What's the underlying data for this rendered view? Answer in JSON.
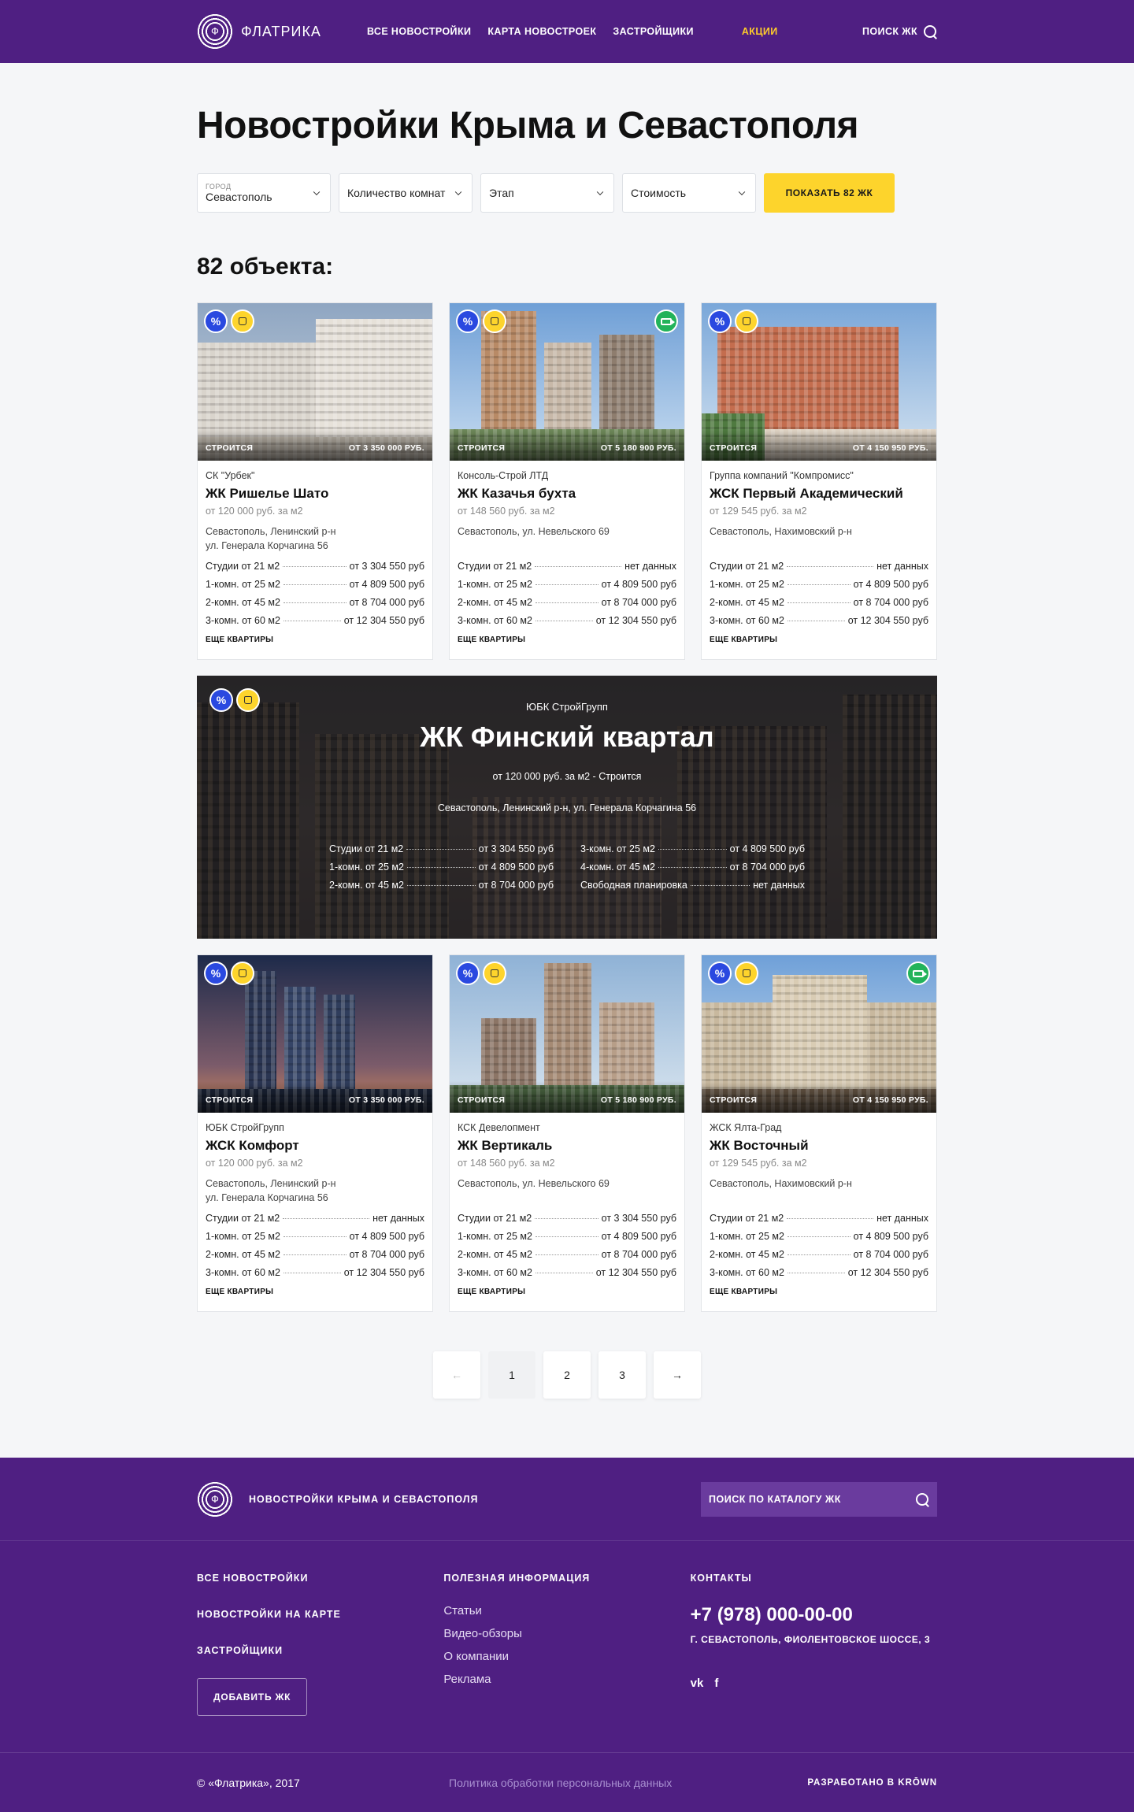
{
  "header": {
    "logo_text": "ФЛАТРИКА",
    "nav": [
      "ВСЕ НОВОСТРОЙКИ",
      "КАРТА НОВОСТРОЕК",
      "ЗАСТРОЙЩИКИ",
      "АКЦИИ"
    ],
    "search_label": "ПОИСК ЖК"
  },
  "page": {
    "title": "Новостройки Крыма и Севастополя",
    "count_title": "82 объекта:"
  },
  "filters": {
    "city_label": "ГОРОД",
    "city_value": "Севастополь",
    "rooms": "Количество комнат",
    "stage": "Этап",
    "price": "Стоимость",
    "show_button": "ПОКАЗАТЬ 82 ЖК"
  },
  "cards": [
    {
      "developer": "СК \"Урбек\"",
      "title": "ЖК Ришелье Шато",
      "price_m2": "от 120 000 руб. за м2",
      "address": [
        "Севастополь, Ленинский р-н",
        "ул. Генерала Корчагина 56"
      ],
      "status": "СТРОИТСЯ",
      "price_from": "ОТ 3 350 000 РУБ.",
      "rows": [
        [
          "Студии от 21 м2",
          "от 3 304 550 руб"
        ],
        [
          "1-комн. от 25 м2",
          "от 4 809 500 руб"
        ],
        [
          "2-комн. от 45 м2",
          "от 8 704 000 руб"
        ],
        [
          "3-комн. от 60 м2",
          "от 12 304 550 руб"
        ]
      ],
      "more": "ЕЩЕ КВАРТИРЫ"
    },
    {
      "developer": "Консоль-Строй ЛТД",
      "title": "ЖК Казачья бухта",
      "price_m2": "от 148 560 руб. за м2",
      "address": [
        "Севастополь, ул. Невельского 69",
        ""
      ],
      "status": "СТРОИТСЯ",
      "price_from": "ОТ 5 180 900 РУБ.",
      "rows": [
        [
          "Студии от 21 м2",
          "нет данных"
        ],
        [
          "1-комн. от 25 м2",
          "от 4 809 500 руб"
        ],
        [
          "2-комн. от 45 м2",
          "от 8 704 000 руб"
        ],
        [
          "3-комн. от 60 м2",
          "от 12 304 550 руб"
        ]
      ],
      "more": "ЕЩЕ КВАРТИРЫ"
    },
    {
      "developer": "Группа компаний \"Компромисс\"",
      "title": "ЖСК Первый Академический",
      "price_m2": "от 129 545 руб. за м2",
      "address": [
        "Севастополь, Нахимовский р-н",
        ""
      ],
      "status": "СТРОИТСЯ",
      "price_from": "ОТ 4 150 950 РУБ.",
      "rows": [
        [
          "Студии от 21 м2",
          "нет данных"
        ],
        [
          "1-комн. от 25 м2",
          "от 4 809 500 руб"
        ],
        [
          "2-комн. от 45 м2",
          "от 8 704 000 руб"
        ],
        [
          "3-комн. от 60 м2",
          "от 12 304 550 руб"
        ]
      ],
      "more": "ЕЩЕ КВАРТИРЫ"
    },
    {
      "developer": "ЮБК СтройГрупп",
      "title": "ЖСК Комфорт",
      "price_m2": "от 120 000 руб. за м2",
      "address": [
        "Севастополь, Ленинский р-н",
        "ул. Генерала Корчагина 56"
      ],
      "status": "СТРОИТСЯ",
      "price_from": "ОТ 3 350 000 РУБ.",
      "rows": [
        [
          "Студии от 21 м2",
          "нет данных"
        ],
        [
          "1-комн. от 25 м2",
          "от 4 809 500 руб"
        ],
        [
          "2-комн. от 45 м2",
          "от 8 704 000 руб"
        ],
        [
          "3-комн. от 60 м2",
          "от 12 304 550 руб"
        ]
      ],
      "more": "ЕЩЕ КВАРТИРЫ"
    },
    {
      "developer": "КСК Девелопмент",
      "title": "ЖК Вертикаль",
      "price_m2": "от 148 560 руб. за м2",
      "address": [
        "Севастополь, ул. Невельского 69",
        ""
      ],
      "status": "СТРОИТСЯ",
      "price_from": "ОТ 5 180 900 РУБ.",
      "rows": [
        [
          "Студии от 21 м2",
          "от 3 304 550 руб"
        ],
        [
          "1-комн. от 25 м2",
          "от 4 809 500 руб"
        ],
        [
          "2-комн. от 45 м2",
          "от 8 704 000 руб"
        ],
        [
          "3-комн. от 60 м2",
          "от 12 304 550 руб"
        ]
      ],
      "more": "ЕЩЕ КВАРТИРЫ"
    },
    {
      "developer": "ЖСК Ялта-Град",
      "title": "ЖК Восточный",
      "price_m2": "от 129 545 руб. за м2",
      "address": [
        "Севастополь, Нахимовский р-н",
        ""
      ],
      "status": "СТРОИТСЯ",
      "price_from": "ОТ 4 150 950 РУБ.",
      "rows": [
        [
          "Студии от 21 м2",
          "нет данных"
        ],
        [
          "1-комн. от 25 м2",
          "от 4 809 500 руб"
        ],
        [
          "2-комн. от 45 м2",
          "от 8 704 000 руб"
        ],
        [
          "3-комн. от 60 м2",
          "от 12 304 550 руб"
        ]
      ],
      "more": "ЕЩЕ КВАРТИРЫ"
    }
  ],
  "featured": {
    "developer": "ЮБК СтройГрупп",
    "title": "ЖК Финский квартал",
    "price_line": "от 120 000 руб. за м2 - Строится",
    "address": "Севастополь, Ленинский р-н, ул. Генерала Корчагина 56",
    "left_rows": [
      [
        "Студии от 21 м2",
        "от 3 304 550 руб"
      ],
      [
        "1-комн. от 25 м2",
        "от 4 809 500 руб"
      ],
      [
        "2-комн. от 45 м2",
        "от 8 704 000 руб"
      ]
    ],
    "right_rows": [
      [
        "3-комн. от 25 м2",
        "от 4 809 500 руб"
      ],
      [
        "4-комн. от 45 м2",
        "от 8 704 000 руб"
      ],
      [
        "Свободная планировка",
        "нет данных"
      ]
    ]
  },
  "badges": {
    "discount": "%",
    "like": "👍"
  },
  "pagination": {
    "pages": [
      "1",
      "2",
      "3"
    ],
    "prev": "←",
    "next": "→"
  },
  "footer": {
    "tagline": "НОВОСТРОЙКИ КРЫМА И СЕВАСТОПОЛЯ",
    "search_placeholder": "ПОИСК ПО КАТАЛОГУ ЖК",
    "col1": [
      "ВСЕ НОВОСТРОЙКИ",
      "НОВОСТРОЙКИ НА КАРТЕ",
      "ЗАСТРОЙЩИКИ"
    ],
    "add_button": "ДОБАВИТЬ ЖК",
    "col2_title": "ПОЛЕЗНАЯ ИНФОРМАЦИЯ",
    "col2": [
      "Статьи",
      "Видео-обзоры",
      "О компании",
      "Реклама"
    ],
    "col3_title": "КОНТАКТЫ",
    "phone": "+7 (978) 000-00-00",
    "address": "Г. СЕВАСТОПОЛЬ, ФИОЛЕНТОВСКОЕ ШОССЕ, 3",
    "socials": [
      "vk",
      "f"
    ],
    "copyright": "© «Флатрика», 2017",
    "policy": "Политика обработки персональных данных",
    "developed_by": "РАЗРАБОТАНО В KRŌWN"
  },
  "colors": {
    "brand": "#4f1f82",
    "accent": "#fdd42c",
    "discount": "#2a49e0",
    "video": "#22b35a"
  }
}
